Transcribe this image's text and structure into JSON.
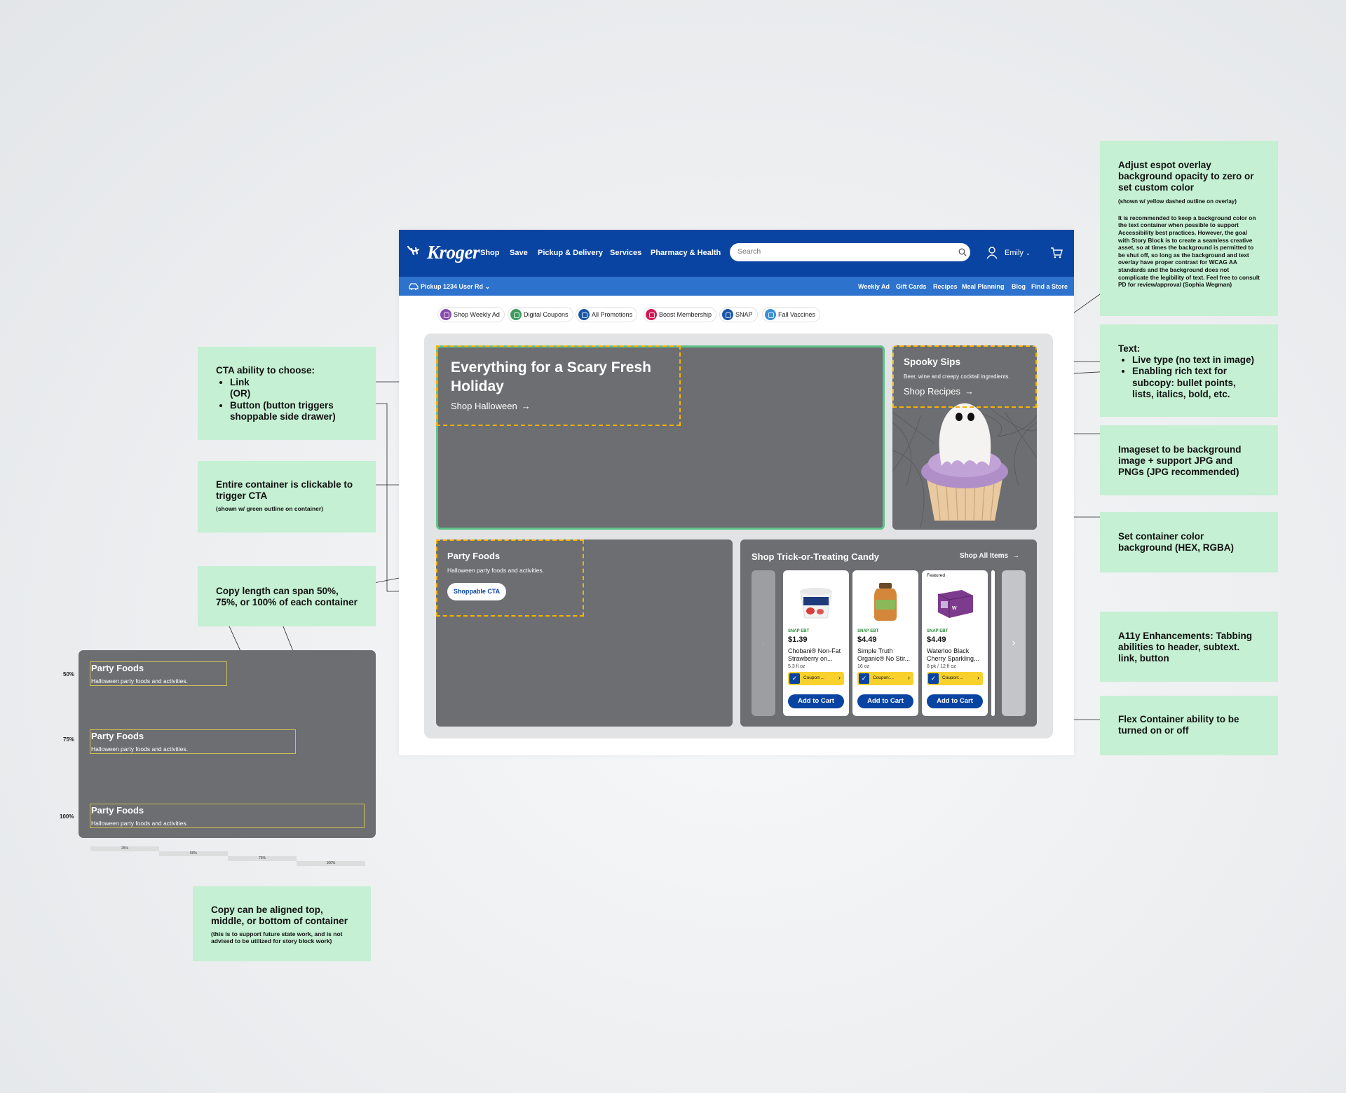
{
  "header": {
    "logo": "Kroger",
    "nav": [
      "Shop",
      "Save",
      "Pickup & Delivery",
      "Services",
      "Pharmacy & Health"
    ],
    "search_placeholder": "Search",
    "user": "Emily"
  },
  "subbar": {
    "pickup": "Pickup 1234 User Rd",
    "links": [
      "Weekly Ad",
      "Gift Cards",
      "Recipes",
      "Meal Planning",
      "Blog",
      "Find a Store"
    ]
  },
  "quick_links": [
    {
      "label": "Shop Weekly Ad",
      "color": "#8a4bb0"
    },
    {
      "label": "Digital Coupons",
      "color": "#3f9a5d"
    },
    {
      "label": "All Promotions",
      "color": "#1a55a8"
    },
    {
      "label": "Boost Membership",
      "color": "#d11a55"
    },
    {
      "label": "SNAP",
      "color": "#1a55a8"
    },
    {
      "label": "Fall Vaccines",
      "color": "#3a8fd6"
    }
  ],
  "hero": {
    "title": "Everything for a Scary Fresh Holiday",
    "link": "Shop Halloween"
  },
  "spooky": {
    "title": "Spooky Sips",
    "subtitle": "Beer, wine and creepy cocktail ingredients.",
    "link": "Shop Recipes"
  },
  "party": {
    "title": "Party Foods",
    "subtitle": "Halloween party foods and activities.",
    "button": "Shoppable CTA"
  },
  "candy": {
    "title": "Shop Trick-or-Treating Candy",
    "link": "Shop All Items",
    "products": [
      {
        "featured": "",
        "snap": "SNAP EBT",
        "price": "$1.39",
        "name": "Chobani® Non-Fat Strawberry on...",
        "size": "5.3 fl oz",
        "coupon": "Coupon:...",
        "cta": "Add to Cart"
      },
      {
        "featured": "",
        "snap": "SNAP EBT",
        "price": "$4.49",
        "name": "Simple Truth Organic® No Stir...",
        "size": "16 oz",
        "coupon": "Coupon:...",
        "cta": "Add to Cart"
      },
      {
        "featured": "Featured",
        "snap": "SNAP EBT",
        "price": "$4.49",
        "name": "Waterloo Black Cherry Sparkling...",
        "size": "8 pk / 12 fl oz",
        "coupon": "Coupon:...",
        "cta": "Add to Cart"
      }
    ]
  },
  "notes": {
    "cta": {
      "title": "CTA ability to choose:",
      "items": [
        "Link",
        "(OR)",
        "Button (button triggers shoppable side drawer)"
      ]
    },
    "clickable": {
      "title": "Entire container is clickable to trigger CTA",
      "small": "(shown w/ green outline on container)"
    },
    "copy_length": {
      "title": "Copy length can span 50%, 75%, or 100% of each container"
    },
    "align": {
      "title": "Copy can be aligned top, middle, or bottom of container",
      "small": "(this is to support future state work, and is not advised to be utilized for story block work)"
    },
    "overlay": {
      "title": "Adjust espot overlay background opacity to zero or set custom color",
      "small": "(shown w/ yellow dashed outline on overlay)",
      "para": "It is recommended to keep a background color on the text container when possible to support Accessibility best practices. However, the goal with Story Block is to create a seamless creative asset, so at times the background is permitted to be shut off, so long as the background and text overlay have proper contrast for WCAG AA standards and the background does not complicate the legibility of text. Feel free to consult PD for review/approval (Sophia Wegman)"
    },
    "text": {
      "title": "Text:",
      "items": [
        "Live type (no text in image)",
        "Enabling rich text for subcopy: bullet points, lists, italics, bold, etc."
      ]
    },
    "imageset": {
      "title": "Imageset to be background image + support JPG and PNGs (JPG recommended)"
    },
    "color": {
      "title": "Set container color background (HEX, RGBA)"
    },
    "a11y": {
      "title": "A11y Enhancements: Tabbing abilities to header, subtext. link, button"
    },
    "flex": {
      "title": "Flex Container ability to be turned on or off"
    }
  },
  "length_demo": {
    "title": "Party Foods",
    "subtitle": "Halloween party foods and activities.",
    "labels": [
      "50%",
      "75%",
      "100%"
    ],
    "bars": [
      "25%",
      "50%",
      "75%",
      "100%"
    ]
  },
  "colors": {
    "brand_blue": "#0a44a2",
    "sub_blue": "#2d72cc",
    "tile_gray": "#6c6e71",
    "note_green": "#c5f0d3",
    "dash_yellow": "#f6b200",
    "outline_green": "#5fc18a"
  }
}
